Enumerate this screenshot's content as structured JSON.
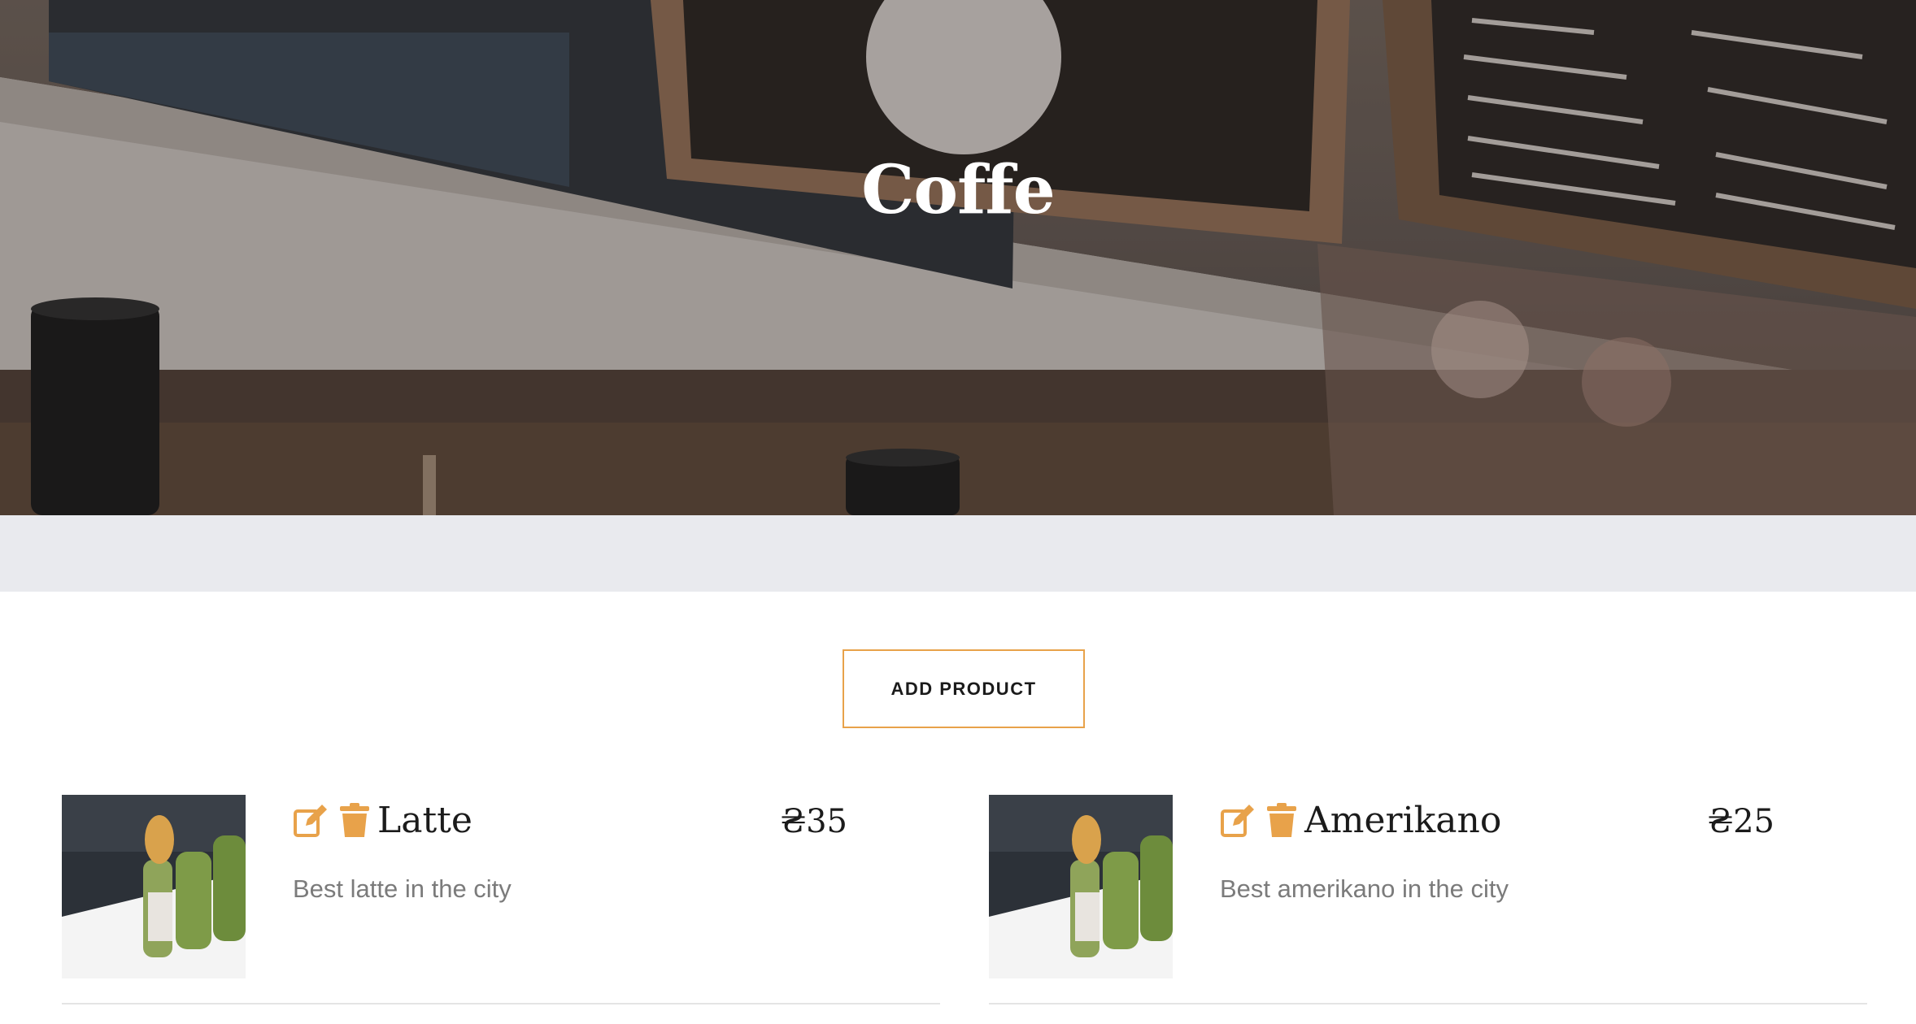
{
  "hero": {
    "title": "Coffe"
  },
  "actions": {
    "add_product_label": "ADD PRODUCT"
  },
  "products": [
    {
      "name": "Latte",
      "price": "₴35",
      "description": "Best latte in the city",
      "image": "sushi-roll-photo"
    },
    {
      "name": "Amerikano",
      "price": "₴25",
      "description": "Best amerikano in the city",
      "image": "sushi-roll-photo"
    }
  ],
  "icons": {
    "edit": "edit-icon",
    "delete": "trash-icon"
  },
  "colors": {
    "accent": "#e8a24a",
    "strip": "#e9eaee",
    "text": "#1b1b1b",
    "muted": "#7b7b7b"
  }
}
